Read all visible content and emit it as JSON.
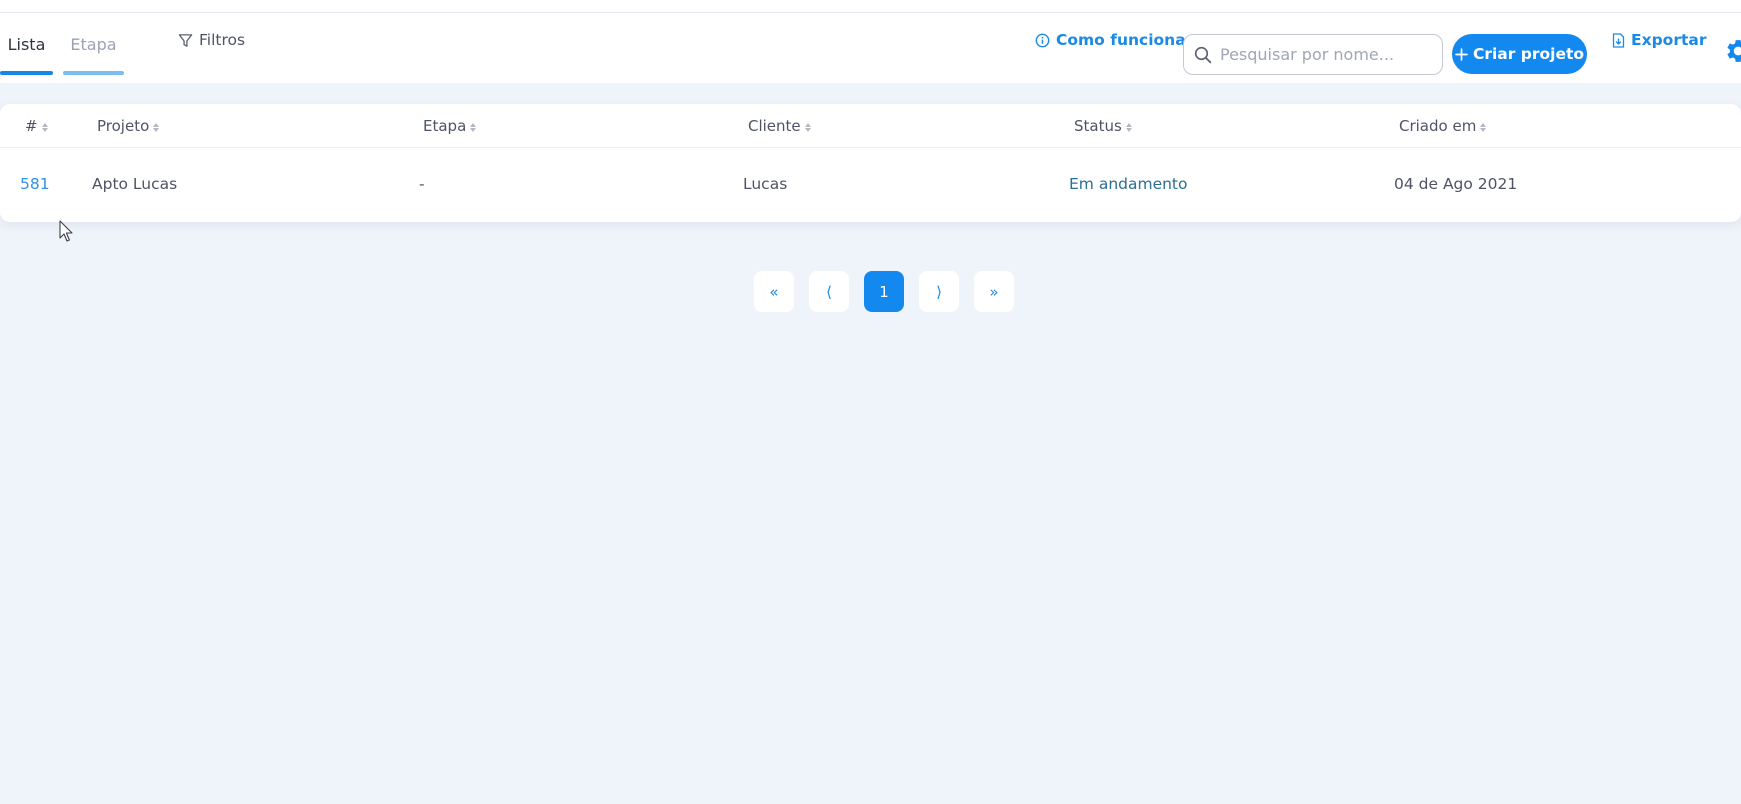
{
  "tabs": [
    {
      "label": "Lista",
      "active": true
    },
    {
      "label": "Etapa",
      "active": false
    }
  ],
  "toolbar": {
    "filters_label": "Filtros",
    "how_label": "Como funciona",
    "search_placeholder": "Pesquisar por nome...",
    "create_label": "Criar projeto",
    "export_label": "Exportar"
  },
  "icons": {
    "filter": "filter-icon",
    "info": "info-icon",
    "search": "search-icon",
    "plus": "plus-icon",
    "export": "file-export-icon",
    "gear": "gear-icon",
    "sort": "sort-icon",
    "cursor": "mouse-pointer-icon"
  },
  "table": {
    "columns": [
      "#",
      "Projeto",
      "Etapa",
      "Cliente",
      "Status",
      "Criado em"
    ],
    "rows": [
      {
        "id": "581",
        "projeto": "Apto Lucas",
        "etapa": "-",
        "cliente": "Lucas",
        "status": "Em andamento",
        "criado_em": "04 de Ago 2021"
      }
    ]
  },
  "pagination": {
    "first": "«",
    "prev": "⟨",
    "current": "1",
    "next": "⟩",
    "last": "»"
  },
  "colors": {
    "accent": "#1389f0",
    "background": "#eff3fa",
    "link": "#1b8ae6",
    "status": "#2b6f95"
  }
}
